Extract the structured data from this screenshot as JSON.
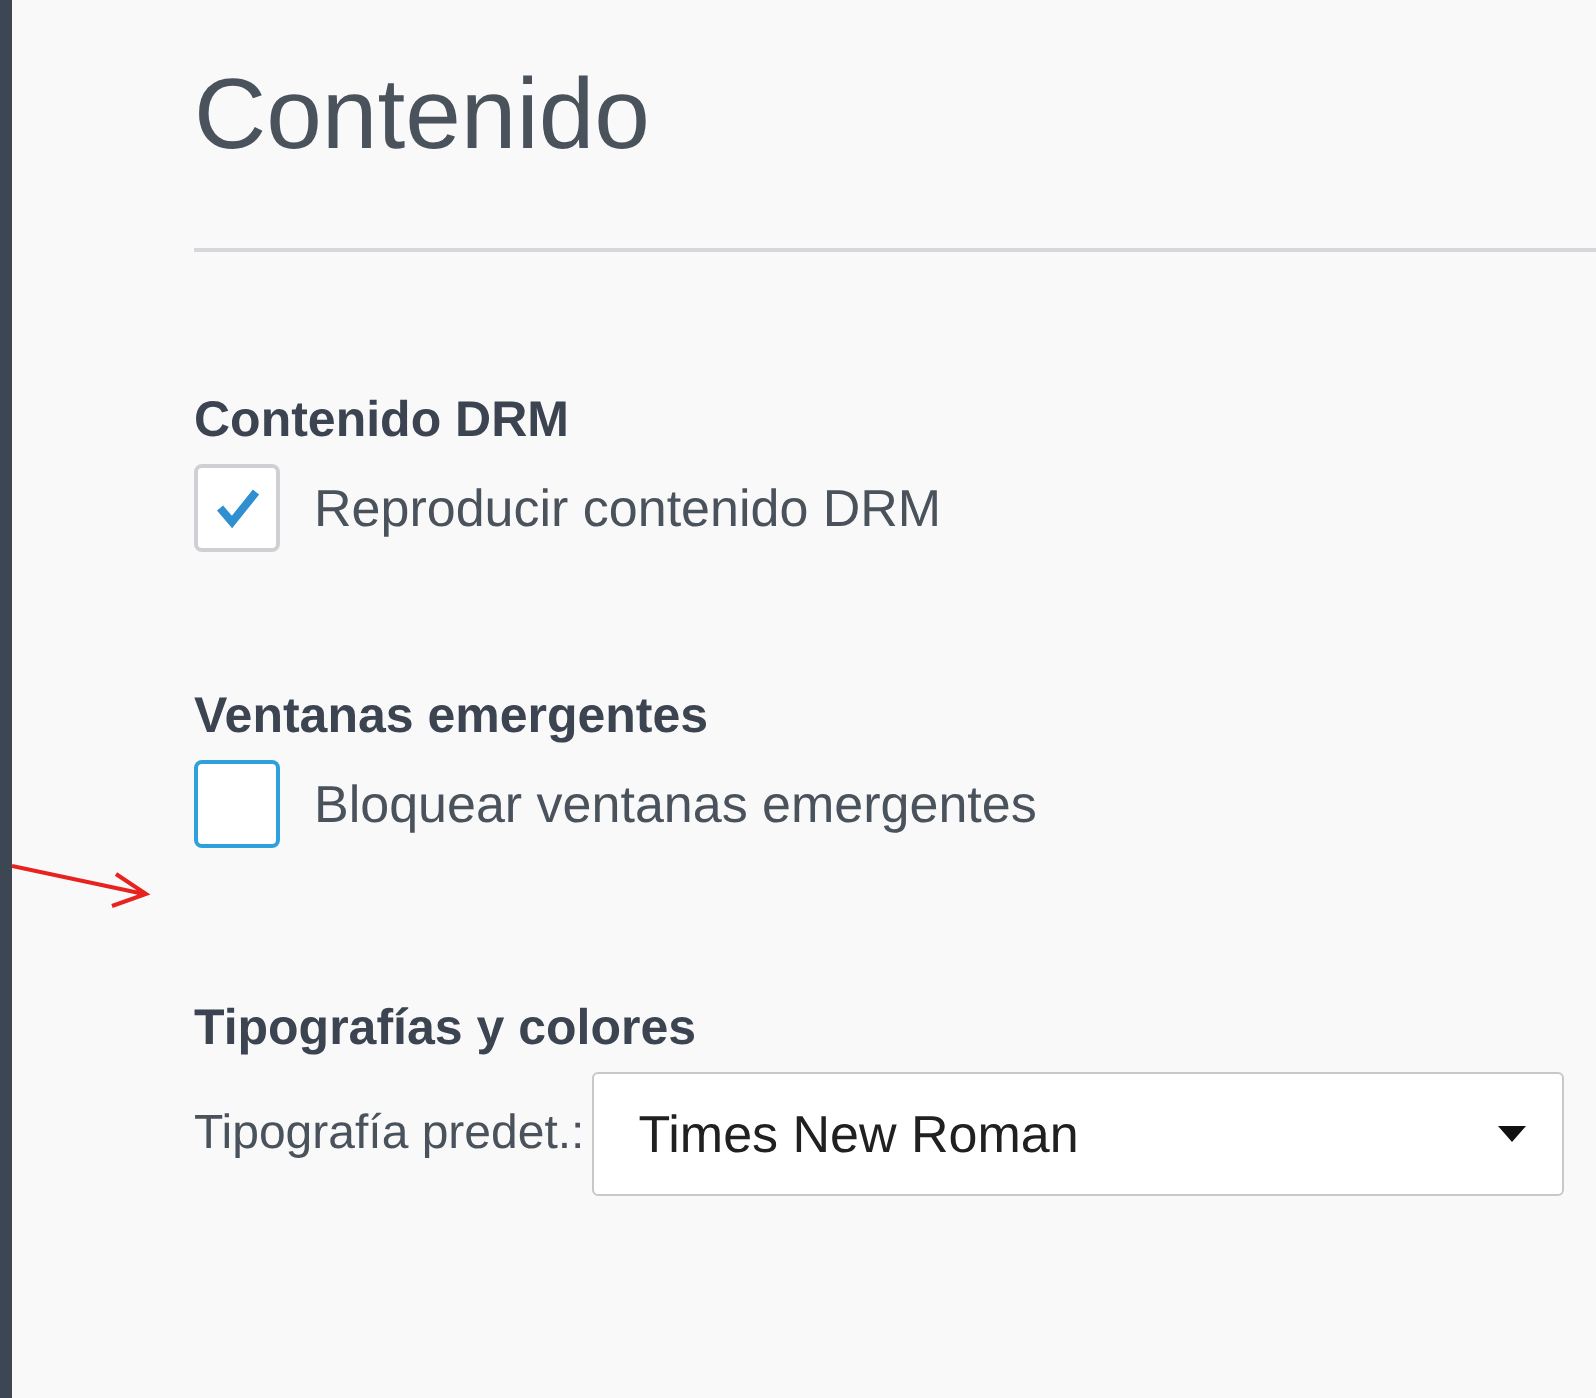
{
  "title": "Contenido",
  "sections": [
    {
      "heading": "Contenido DRM",
      "kind": "checkbox",
      "label": "Reproducir contenido DRM",
      "checked": true
    },
    {
      "heading": "Ventanas emergentes",
      "kind": "checkbox",
      "label": "Bloquear ventanas emergentes",
      "checked": false,
      "focused": true
    },
    {
      "heading": "Tipografías y colores",
      "kind": "select",
      "label": "Tipografía predet.:",
      "value": "Times New Roman"
    }
  ]
}
